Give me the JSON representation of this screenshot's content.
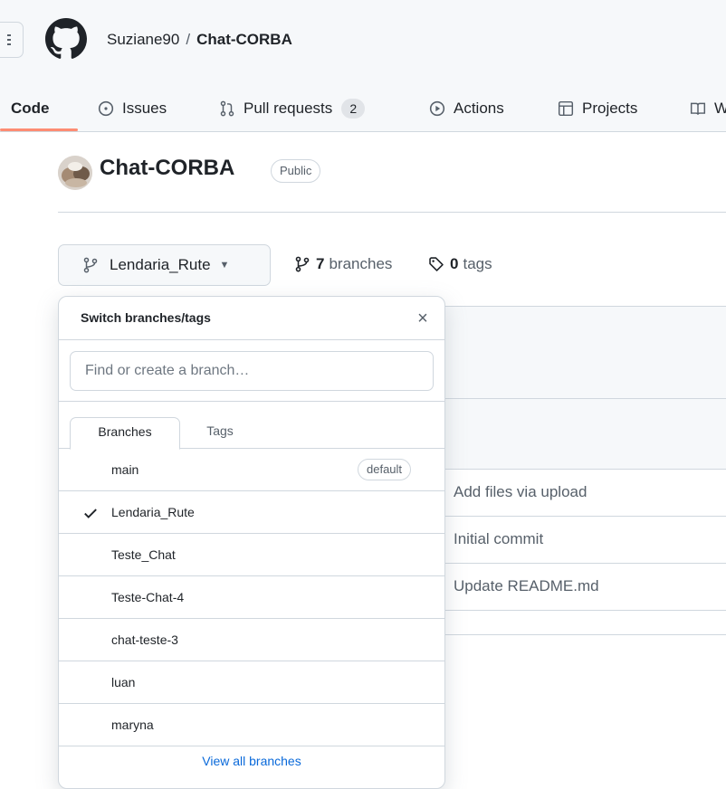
{
  "header": {
    "owner": "Suziane90",
    "separator": "/",
    "repo": "Chat-CORBA"
  },
  "nav": {
    "tabs": [
      {
        "label": "Code",
        "icon": "code-icon",
        "active": true
      },
      {
        "label": "Issues",
        "icon": "issue-icon"
      },
      {
        "label": "Pull requests",
        "icon": "pull-request-icon",
        "count": "2"
      },
      {
        "label": "Actions",
        "icon": "play-icon"
      },
      {
        "label": "Projects",
        "icon": "table-icon"
      },
      {
        "label": "W",
        "icon": "book-icon"
      }
    ]
  },
  "repo": {
    "title": "Chat-CORBA",
    "visibility": "Public"
  },
  "branch_bar": {
    "current_branch": "Lendaria_Rute",
    "branches_count": "7",
    "branches_label": "branches",
    "tags_count": "0",
    "tags_label": "tags"
  },
  "dropdown": {
    "title": "Switch branches/tags",
    "close": "×",
    "search_placeholder": "Find or create a branch…",
    "tabs": {
      "branches": "Branches",
      "tags": "Tags"
    },
    "items": [
      {
        "name": "main",
        "badge": "default"
      },
      {
        "name": "Lendaria_Rute",
        "selected": true
      },
      {
        "name": "Teste_Chat"
      },
      {
        "name": "Teste-Chat-4"
      },
      {
        "name": "chat-teste-3"
      },
      {
        "name": "luan"
      },
      {
        "name": "maryna"
      }
    ],
    "footer_link": "View all branches"
  },
  "files": {
    "commits": [
      "Add files via upload",
      "Initial commit",
      "Update README.md"
    ]
  },
  "colors": {
    "accent_underline": "#fd8c73",
    "link": "#0969da",
    "border": "#d0d7de",
    "header_bg": "#f6f8fa"
  }
}
